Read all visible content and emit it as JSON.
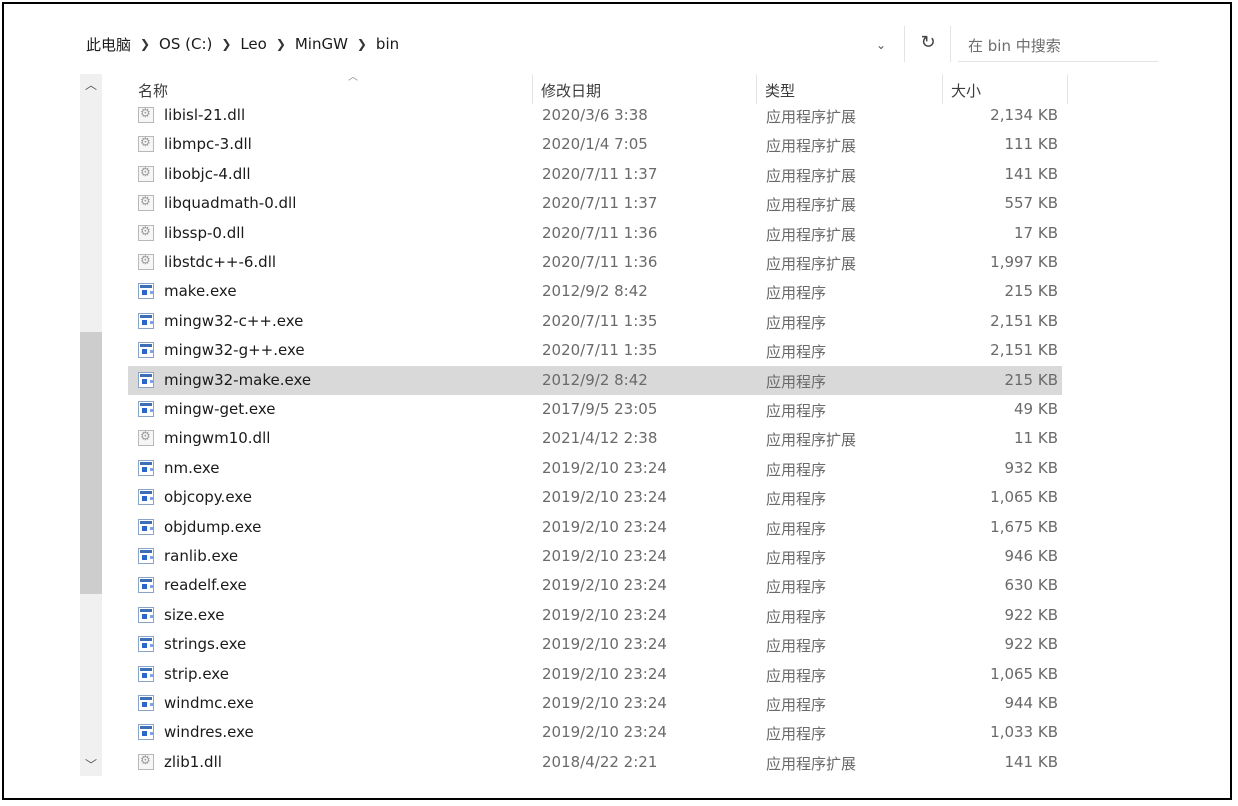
{
  "breadcrumb": [
    "此电脑",
    "OS (C:)",
    "Leo",
    "MinGW",
    "bin"
  ],
  "search": {
    "placeholder": "在 bin 中搜索"
  },
  "columns": {
    "name": "名称",
    "date": "修改日期",
    "type": "类型",
    "size": "大小"
  },
  "files": [
    {
      "name": "libisl-21.dll",
      "date": "2020/3/6 3:38",
      "type": "应用程序扩展",
      "size": "2,134 KB",
      "icon": "dll-icon"
    },
    {
      "name": "libmpc-3.dll",
      "date": "2020/1/4 7:05",
      "type": "应用程序扩展",
      "size": "111 KB",
      "icon": "dll-icon"
    },
    {
      "name": "libobjc-4.dll",
      "date": "2020/7/11 1:37",
      "type": "应用程序扩展",
      "size": "141 KB",
      "icon": "dll-icon"
    },
    {
      "name": "libquadmath-0.dll",
      "date": "2020/7/11 1:37",
      "type": "应用程序扩展",
      "size": "557 KB",
      "icon": "dll-icon"
    },
    {
      "name": "libssp-0.dll",
      "date": "2020/7/11 1:36",
      "type": "应用程序扩展",
      "size": "17 KB",
      "icon": "dll-icon"
    },
    {
      "name": "libstdc++-6.dll",
      "date": "2020/7/11 1:36",
      "type": "应用程序扩展",
      "size": "1,997 KB",
      "icon": "dll-icon"
    },
    {
      "name": "make.exe",
      "date": "2012/9/2 8:42",
      "type": "应用程序",
      "size": "215 KB",
      "icon": "exe-icon"
    },
    {
      "name": "mingw32-c++.exe",
      "date": "2020/7/11 1:35",
      "type": "应用程序",
      "size": "2,151 KB",
      "icon": "exe-icon"
    },
    {
      "name": "mingw32-g++.exe",
      "date": "2020/7/11 1:35",
      "type": "应用程序",
      "size": "2,151 KB",
      "icon": "exe-icon"
    },
    {
      "name": "mingw32-make.exe",
      "date": "2012/9/2 8:42",
      "type": "应用程序",
      "size": "215 KB",
      "icon": "exe-icon",
      "selected": true
    },
    {
      "name": "mingw-get.exe",
      "date": "2017/9/5 23:05",
      "type": "应用程序",
      "size": "49 KB",
      "icon": "exe-icon"
    },
    {
      "name": "mingwm10.dll",
      "date": "2021/4/12 2:38",
      "type": "应用程序扩展",
      "size": "11 KB",
      "icon": "dll-icon"
    },
    {
      "name": "nm.exe",
      "date": "2019/2/10 23:24",
      "type": "应用程序",
      "size": "932 KB",
      "icon": "exe-icon"
    },
    {
      "name": "objcopy.exe",
      "date": "2019/2/10 23:24",
      "type": "应用程序",
      "size": "1,065 KB",
      "icon": "exe-icon"
    },
    {
      "name": "objdump.exe",
      "date": "2019/2/10 23:24",
      "type": "应用程序",
      "size": "1,675 KB",
      "icon": "exe-icon"
    },
    {
      "name": "ranlib.exe",
      "date": "2019/2/10 23:24",
      "type": "应用程序",
      "size": "946 KB",
      "icon": "exe-icon"
    },
    {
      "name": "readelf.exe",
      "date": "2019/2/10 23:24",
      "type": "应用程序",
      "size": "630 KB",
      "icon": "exe-icon"
    },
    {
      "name": "size.exe",
      "date": "2019/2/10 23:24",
      "type": "应用程序",
      "size": "922 KB",
      "icon": "exe-icon"
    },
    {
      "name": "strings.exe",
      "date": "2019/2/10 23:24",
      "type": "应用程序",
      "size": "922 KB",
      "icon": "exe-icon"
    },
    {
      "name": "strip.exe",
      "date": "2019/2/10 23:24",
      "type": "应用程序",
      "size": "1,065 KB",
      "icon": "exe-icon"
    },
    {
      "name": "windmc.exe",
      "date": "2019/2/10 23:24",
      "type": "应用程序",
      "size": "944 KB",
      "icon": "exe-icon"
    },
    {
      "name": "windres.exe",
      "date": "2019/2/10 23:24",
      "type": "应用程序",
      "size": "1,033 KB",
      "icon": "exe-icon"
    },
    {
      "name": "zlib1.dll",
      "date": "2018/4/22 2:21",
      "type": "应用程序扩展",
      "size": "141 KB",
      "icon": "dll-icon"
    }
  ]
}
